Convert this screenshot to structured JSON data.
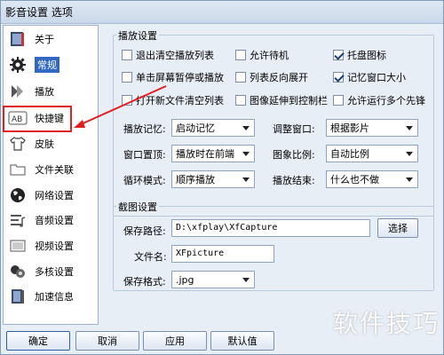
{
  "window": {
    "title": "影音设置 选项"
  },
  "sidebar": {
    "items": [
      {
        "label": "关于",
        "icon": "info-book-icon"
      },
      {
        "label": "常规",
        "icon": "gear-icon",
        "active": true
      },
      {
        "label": "播放",
        "icon": "play-icon"
      },
      {
        "label": "快捷键",
        "icon": "keyboard-ab-icon"
      },
      {
        "label": "皮肤",
        "icon": "shirt-icon"
      },
      {
        "label": "文件关联",
        "icon": "folder-icon"
      },
      {
        "label": "网络设置",
        "icon": "globe-icon"
      },
      {
        "label": "音频设置",
        "icon": "audio-icon"
      },
      {
        "label": "视频设置",
        "icon": "video-icon"
      },
      {
        "label": "多核设置",
        "icon": "multicore-icon"
      },
      {
        "label": "加速信息",
        "icon": "accelerate-icon"
      }
    ]
  },
  "playback": {
    "group_title": "播放设置",
    "checkboxes": [
      {
        "label": "退出清空播放列表",
        "checked": false
      },
      {
        "label": "允许待机",
        "checked": false
      },
      {
        "label": "托盘图标",
        "checked": true
      },
      {
        "label": "单击屏幕暂停或播放",
        "checked": false
      },
      {
        "label": "列表反向展开",
        "checked": false
      },
      {
        "label": "记忆窗口大小",
        "checked": true
      },
      {
        "label": "打开新文件清空列表",
        "checked": false
      },
      {
        "label": "图像延伸到控制栏",
        "checked": false
      },
      {
        "label": "允许运行多个先锋",
        "checked": false
      }
    ],
    "memory_label": "播放记忆:",
    "memory_value": "启动记忆",
    "adjust_label": "调整窗口:",
    "adjust_value": "根据影片",
    "ontop_label": "窗口置顶:",
    "ontop_value": "播放时在前端",
    "ratio_label": "图象比例:",
    "ratio_value": "自动比例",
    "loop_label": "循环模式:",
    "loop_value": "顺序播放",
    "end_label": "播放结束:",
    "end_value": "什么也不做"
  },
  "capture": {
    "group_title": "截图设置",
    "path_label": "保存路径:",
    "path_value": "D:\\xfplay\\XfCapture",
    "browse_label": "选择",
    "name_label": "文件名:",
    "name_value": "XFpicture",
    "format_label": "保存格式:",
    "format_value": ".jpg"
  },
  "buttons": {
    "ok": "确定",
    "cancel": "取消",
    "apply": "应用",
    "default": "默认值"
  },
  "watermark": "软件技巧",
  "colors": {
    "accent": "#3168c4",
    "highlight": "#e02020"
  }
}
